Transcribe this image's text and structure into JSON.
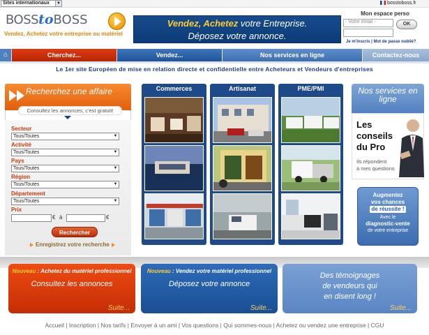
{
  "topbar": {
    "sites_select": "Sites internationaux",
    "domain": "bosstoboss.fr"
  },
  "logo": {
    "part1": "BOSS",
    "part2": "to",
    "part3": "BOSS",
    "tagline": "Vendez, Achetez votre entreprise ou matériel"
  },
  "banner": {
    "line1_a": "Vendez, Achetez",
    "line1_b": " votre Entreprise.",
    "line2": "Déposez votre annonce."
  },
  "login": {
    "title": "Mon espace perso",
    "email_placeholder": "- Votre email -",
    "ok_label": "OK",
    "register_link": "Je m'inscris",
    "separator": "|",
    "forgot_link": "Mot de passe oublié?"
  },
  "nav": {
    "home_icon": "home-icon",
    "items": [
      "Cherchez...",
      "Vendez...",
      "Nos services en ligne",
      "Contactez-nous"
    ]
  },
  "headline": "Le 1er site Européen de mise en relation directe et confidentielle entre Acheteurs et Vendeurs d'entreprises",
  "search": {
    "title": "Recherchez une affaire",
    "subtitle": "Consultez les annonces, c'est gratuit!",
    "fields": [
      {
        "label": "Secteur",
        "value": "Tous/Toutes"
      },
      {
        "label": "Activité",
        "value": "Tous/Toutes"
      },
      {
        "label": "Pays",
        "value": "Tous/Toutes"
      },
      {
        "label": "Région",
        "value": "Tous/Toutes"
      },
      {
        "label": "Département",
        "value": "Tous/Toutes"
      }
    ],
    "price_label": "Prix",
    "currency": "€",
    "to": "à",
    "button": "Rechercher",
    "save": "Enregistrez votre recherche"
  },
  "columns": [
    {
      "title": "Commerces"
    },
    {
      "title": "Artisanat"
    },
    {
      "title": "PME/PMI"
    }
  ],
  "services": {
    "title": "Nos services en ligne",
    "conseils_title_1": "Les",
    "conseils_title_2": "conseils",
    "conseils_title_3": "du Pro",
    "conseils_sub_1": "Ils répondent",
    "conseils_sub_2": "à mes questions",
    "diag_l1": "Augmentez",
    "diag_l2": "vos chances",
    "diag_l3": "de réussite !",
    "diag_l4": "Avec le",
    "diag_l5": "diagnostic-vente",
    "diag_l6": "de votre entreprise"
  },
  "promos": [
    {
      "new": "Nouveau",
      "text": " : Achetez du matériel professionnel",
      "big": "Consultez les annonces",
      "suite": "Suite..."
    },
    {
      "new": "Nouveau",
      "text": " : Vendez votre matériel professionnel",
      "big": "Déposez votre annonce",
      "suite": "Suite..."
    },
    {
      "big1": "Des témoignages",
      "big2": "de vendeurs qui",
      "big3": "en disent long !",
      "suite": "Suite..."
    }
  ],
  "footer": "Accueil | Inscription | Nos tarifs | Envoyer à un ami | Vos questions | Qui sommes-nous | Achetez ou vendez une entreprise | CGU",
  "colors": {
    "orange": "#e15e0a",
    "navy": "#1e4a8a",
    "accent_yellow": "#ffcc33"
  }
}
